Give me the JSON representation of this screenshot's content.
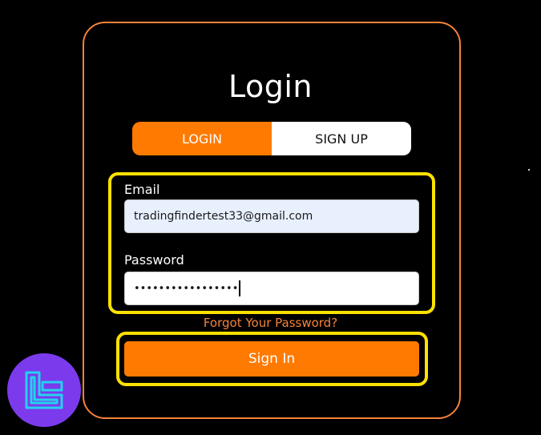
{
  "title": "Login",
  "tabs": [
    {
      "label": "LOGIN",
      "active": true
    },
    {
      "label": "SIGN UP",
      "active": false
    }
  ],
  "form": {
    "email_label": "Email",
    "email_value": "tradingfindertest33@gmail.com",
    "password_label": "Password",
    "password_value": "•••••••••••••••••"
  },
  "forgot_label": "Forgot Your Password?",
  "signin_label": "Sign In",
  "colors": {
    "accent": "#ff7a00",
    "border": "#f5823a",
    "highlight": "#ffe100",
    "logo_bg": "#7c3aed",
    "logo_mark": "#22d3ee"
  }
}
